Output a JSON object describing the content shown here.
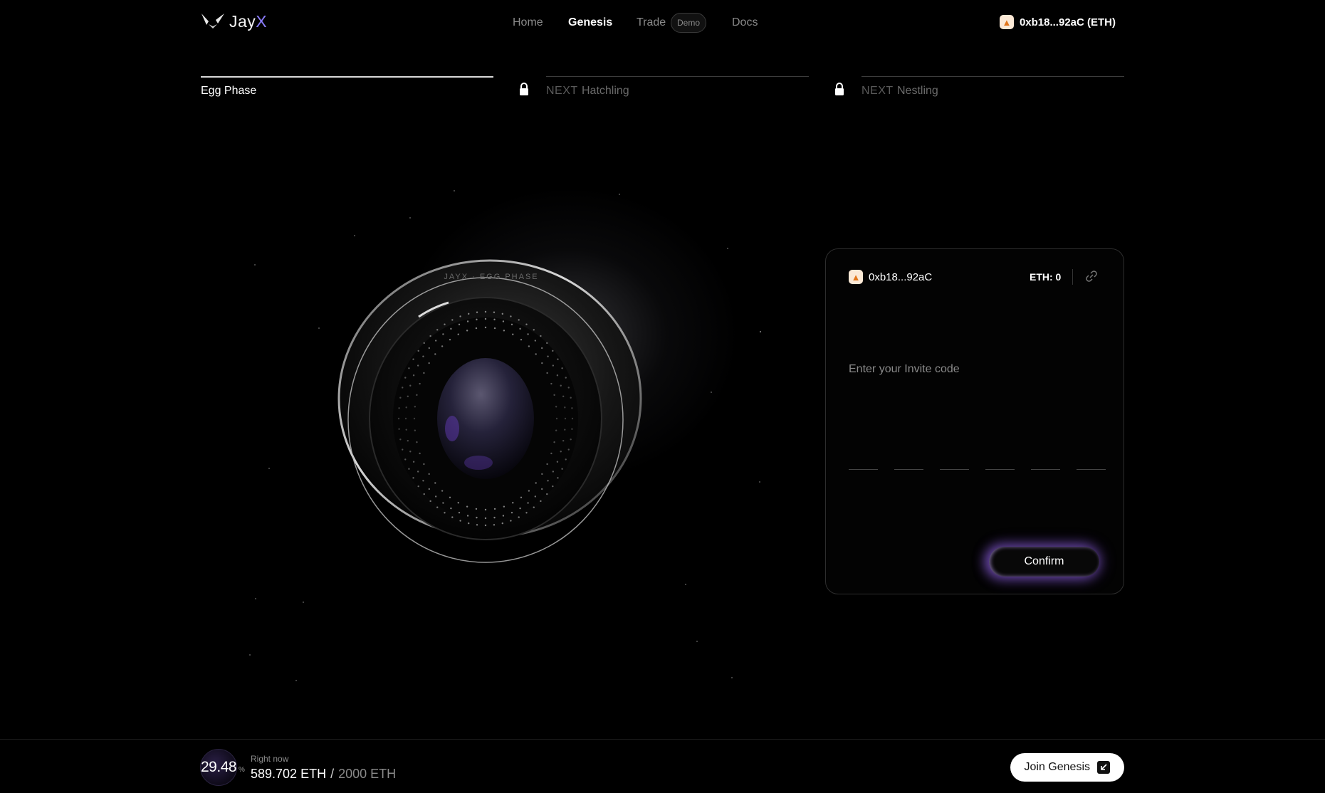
{
  "header": {
    "logo_text": "Jay",
    "logo_accent": "X",
    "nav": {
      "home": "Home",
      "genesis": "Genesis",
      "trade": "Trade",
      "demo_badge": "Demo",
      "docs": "Docs"
    },
    "wallet_label": "0xb18...92aC (ETH)"
  },
  "phases": [
    {
      "label": "Egg Phase",
      "active": true
    },
    {
      "prefix": "NEXT",
      "label": "Hatchling",
      "locked": true
    },
    {
      "prefix": "NEXT",
      "label": "Nestling",
      "locked": true
    }
  ],
  "orb": {
    "ring_text": "JAYX · EGG PHASE"
  },
  "panel": {
    "wallet_address": "0xb18...92aC",
    "eth_balance": "ETH: 0",
    "invite_label": "Enter your Invite code",
    "code_slots": 6,
    "confirm_label": "Confirm"
  },
  "footer": {
    "progress_percent": "29.48",
    "progress_symbol": "%",
    "right_now_label": "Right now",
    "raised": "589.702 ETH",
    "separator": "/",
    "target": "2000 ETH",
    "join_label": "Join Genesis"
  },
  "colors": {
    "accent": "#8b7dff",
    "glow": "#a06eff",
    "background": "#000000"
  }
}
